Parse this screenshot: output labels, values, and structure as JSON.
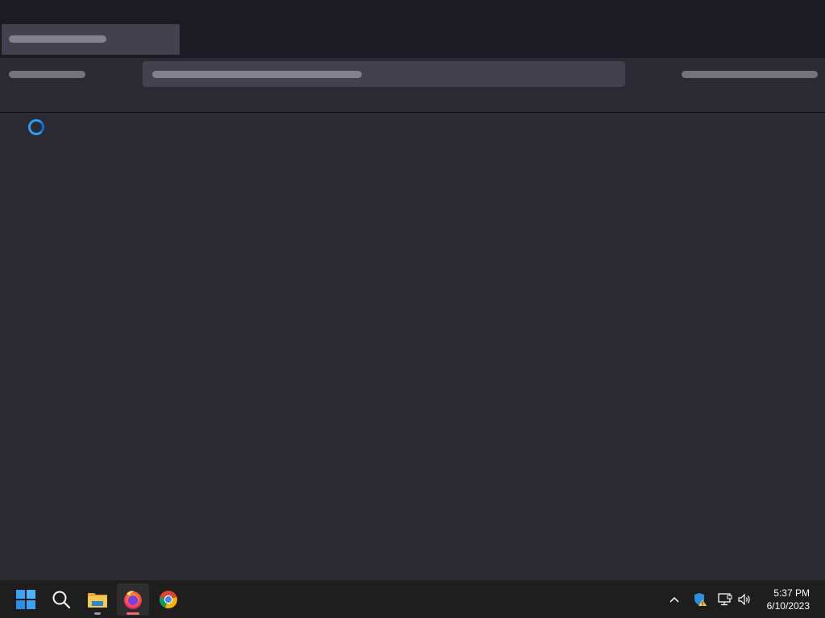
{
  "taskbar": {
    "apps": [
      {
        "icon": "windows-start-icon"
      },
      {
        "icon": "search-icon"
      },
      {
        "icon": "file-explorer-icon",
        "running": true
      },
      {
        "icon": "firefox-icon",
        "running": true,
        "active": true
      },
      {
        "icon": "chrome-icon"
      }
    ],
    "tray": {
      "icons": [
        "chevron-up-icon",
        "windows-security-warning-icon",
        "network-icon",
        "volume-icon"
      ],
      "time": "5:37 PM",
      "date": "6/10/2023"
    }
  },
  "colors": {
    "accent": "#2a9df4",
    "window_bg": "#2b2a33",
    "tabstrip_bg": "#1c1b22",
    "taskbar_bg": "#1e1e1e",
    "active_indicator": "#f06a6a"
  }
}
